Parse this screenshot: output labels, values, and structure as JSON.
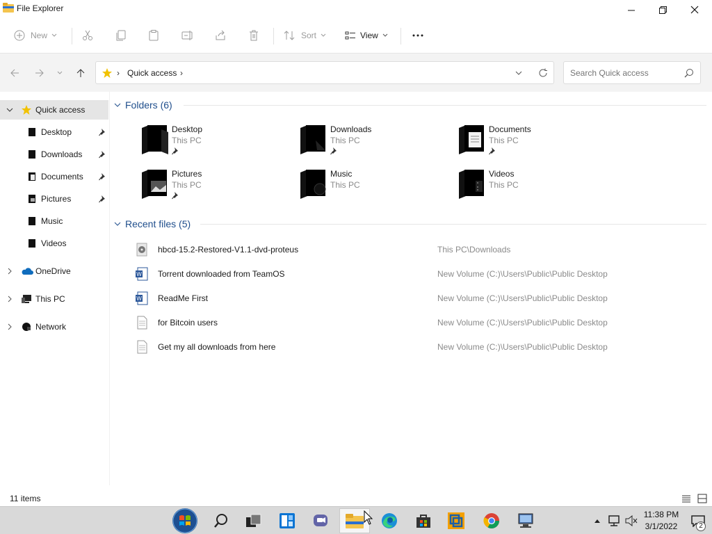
{
  "window": {
    "title": "File Explorer"
  },
  "toolbar": {
    "new_label": "New",
    "sort_label": "Sort",
    "view_label": "View"
  },
  "address_bar": {
    "location": "Quick access"
  },
  "search": {
    "placeholder": "Search Quick access"
  },
  "sidebar": {
    "items": [
      {
        "label": "Quick access",
        "icon": "star-icon",
        "selected": true,
        "expanded": true
      },
      {
        "label": "Desktop",
        "icon": "desktop-folder-icon",
        "pinned": true
      },
      {
        "label": "Downloads",
        "icon": "downloads-folder-icon",
        "pinned": true
      },
      {
        "label": "Documents",
        "icon": "documents-folder-icon",
        "pinned": true
      },
      {
        "label": "Pictures",
        "icon": "pictures-folder-icon",
        "pinned": true
      },
      {
        "label": "Music",
        "icon": "music-folder-icon",
        "pinned": false
      },
      {
        "label": "Videos",
        "icon": "videos-folder-icon",
        "pinned": false
      },
      {
        "label": "OneDrive",
        "icon": "onedrive-icon",
        "expandable": true
      },
      {
        "label": "This PC",
        "icon": "this-pc-icon",
        "expandable": true
      },
      {
        "label": "Network",
        "icon": "network-icon",
        "expandable": true
      }
    ]
  },
  "folders_group": {
    "title": "Folders (6)",
    "items": [
      {
        "name": "Desktop",
        "location": "This PC",
        "pinned": true,
        "icon": "desktop-folder-icon"
      },
      {
        "name": "Downloads",
        "location": "This PC",
        "pinned": true,
        "icon": "downloads-folder-icon"
      },
      {
        "name": "Documents",
        "location": "This PC",
        "pinned": true,
        "icon": "documents-folder-icon"
      },
      {
        "name": "Pictures",
        "location": "This PC",
        "pinned": true,
        "icon": "pictures-folder-icon"
      },
      {
        "name": "Music",
        "location": "This PC",
        "pinned": false,
        "icon": "music-folder-icon"
      },
      {
        "name": "Videos",
        "location": "This PC",
        "pinned": false,
        "icon": "videos-folder-icon"
      }
    ]
  },
  "recent_group": {
    "title": "Recent files (5)",
    "items": [
      {
        "name": "hbcd-15.2-Restored-V1.1-dvd-proteus",
        "path": "This PC\\Downloads",
        "icon": "disc-image-icon"
      },
      {
        "name": "Torrent downloaded from TeamOS",
        "path": "New Volume (C:)\\Users\\Public\\Public Desktop",
        "icon": "word-document-icon"
      },
      {
        "name": "ReadMe First",
        "path": "New Volume (C:)\\Users\\Public\\Public Desktop",
        "icon": "word-document-icon"
      },
      {
        "name": "for Bitcoin users",
        "path": "New Volume (C:)\\Users\\Public\\Public Desktop",
        "icon": "text-file-icon"
      },
      {
        "name": "Get my all downloads from here",
        "path": "New Volume (C:)\\Users\\Public\\Public Desktop",
        "icon": "text-file-icon"
      }
    ]
  },
  "status": {
    "item_count": "11 items"
  },
  "taskbar": {
    "time": "11:38 PM",
    "date": "3/1/2022",
    "notification_count": "2"
  },
  "colors": {
    "accent": "#1f4e8c",
    "selected_bg": "#e5e5e5",
    "address_bg": "#f3f3f3",
    "taskbar_bg": "#d9d9d9",
    "star": "#f2c200",
    "onedrive": "#0f6cbd"
  }
}
